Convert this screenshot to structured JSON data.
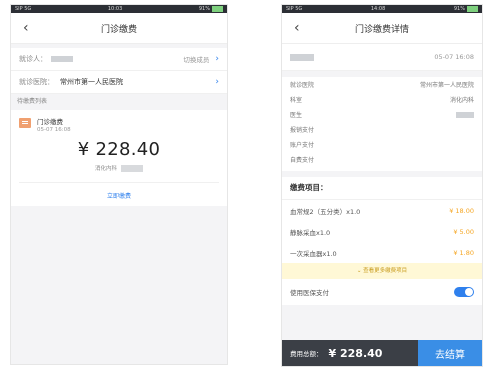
{
  "left": {
    "status": {
      "carrier": "SIP 5G",
      "time": "10:03",
      "battery": "91%"
    },
    "nav": {
      "back": "‹",
      "title": "门诊缴费"
    },
    "patient": {
      "label": "就诊人：",
      "switch": "切换成员"
    },
    "hospital": {
      "label": "就诊医院：",
      "value": "常州市第一人民医院"
    },
    "section": "待缴费列表",
    "item": {
      "name": "门诊缴费",
      "time": "05-07 16:08",
      "amount": "¥ 228.40",
      "dept": "消化内科"
    },
    "pay_link": "立即缴费"
  },
  "right": {
    "status": {
      "carrier": "SIP 5G",
      "time": "14:08",
      "battery": "91%"
    },
    "nav": {
      "back": "‹",
      "title": "门诊缴费详情"
    },
    "head_date": "05-07 16:08",
    "info": [
      {
        "k": "就诊医院",
        "v": "常州市第一人民医院"
      },
      {
        "k": "科室",
        "v": "消化内科"
      },
      {
        "k": "医生",
        "v": ""
      },
      {
        "k": "报销支付",
        "v": ""
      },
      {
        "k": "账户支付",
        "v": ""
      },
      {
        "k": "自费支付",
        "v": ""
      }
    ],
    "fee_title": "缴费项目：",
    "fees": [
      {
        "name": "血常规2（五分类）x1.0",
        "price": "¥ 18.00"
      },
      {
        "name": "静脉采血x1.0",
        "price": "¥ 5.00"
      },
      {
        "name": "一次采血器x1.0",
        "price": "¥ 1.80"
      }
    ],
    "more": "查看更多缴费项目",
    "insurance": "使用医保支付",
    "total_label": "费用总额：",
    "total": "¥ 228.40",
    "checkout": "去结算"
  },
  "colors": {
    "accent": "#2f80ed",
    "price": "#f5a623",
    "bar": "#3b3f46",
    "checkout": "#3a8ee6"
  }
}
